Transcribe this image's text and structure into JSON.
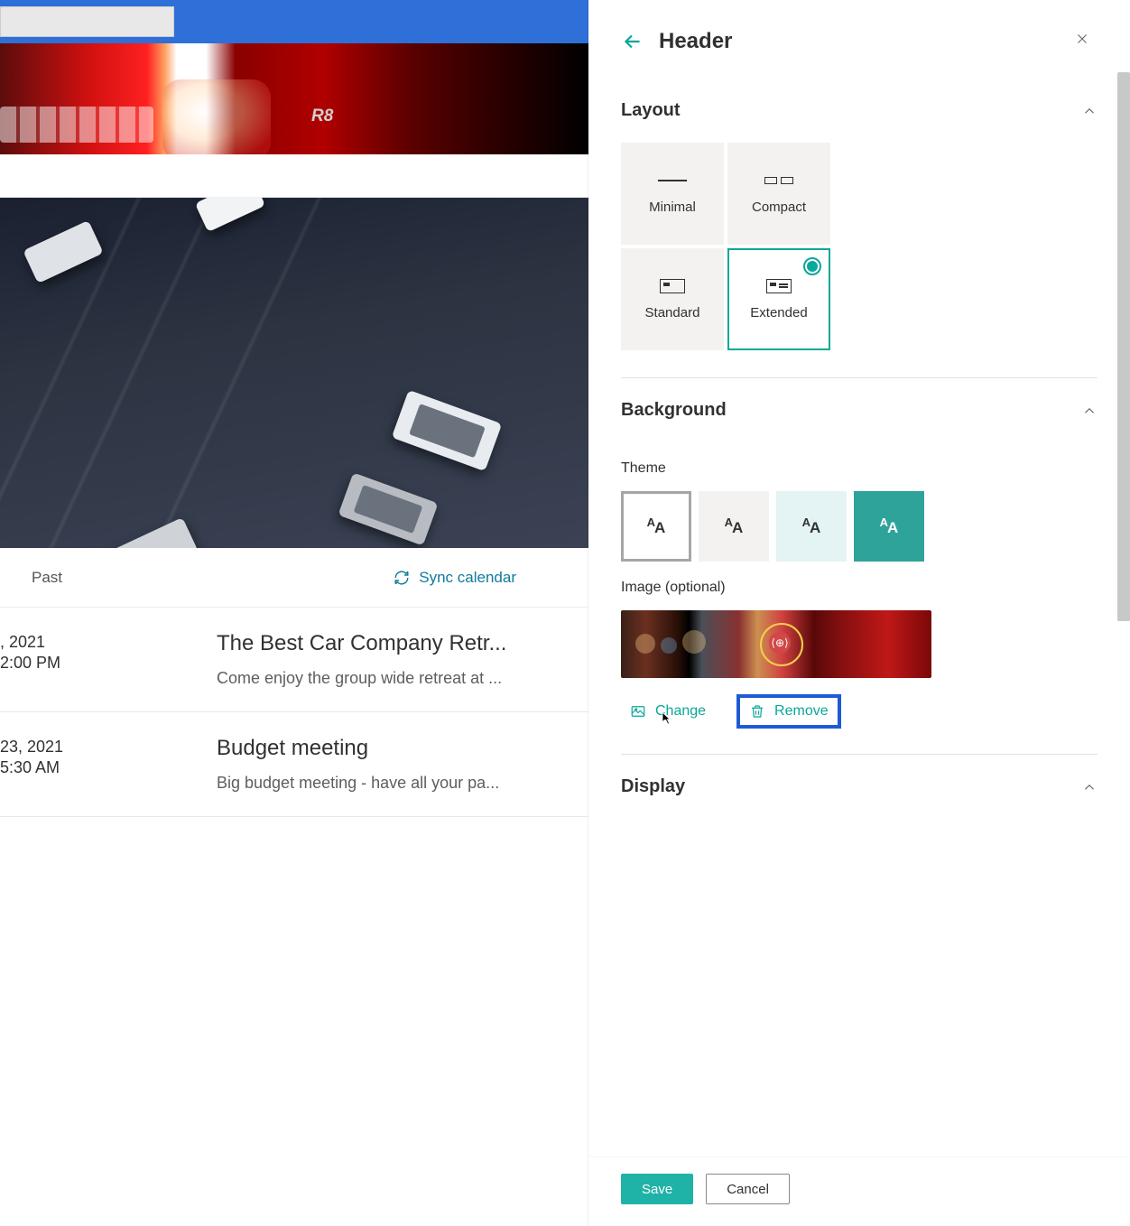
{
  "main": {
    "banner_badge": "R8",
    "tabs": {
      "past": "Past",
      "sync": "Sync calendar"
    },
    "events": [
      {
        "date": ", 2021",
        "time": "2:00 PM",
        "title": "The Best Car Company Retr...",
        "desc": "Come enjoy the group wide retreat at ..."
      },
      {
        "date": "23, 2021",
        "time": "5:30 AM",
        "title": "Budget meeting",
        "desc": "Big budget meeting - have all your pa..."
      }
    ]
  },
  "panel": {
    "title": "Header",
    "sections": {
      "layout": {
        "title": "Layout",
        "options": {
          "minimal": "Minimal",
          "compact": "Compact",
          "standard": "Standard",
          "extended": "Extended"
        },
        "selected": "extended"
      },
      "background": {
        "title": "Background",
        "theme_label": "Theme",
        "image_label": "Image (optional)",
        "change": "Change",
        "remove": "Remove"
      },
      "display": {
        "title": "Display"
      }
    },
    "footer": {
      "save": "Save",
      "cancel": "Cancel"
    }
  },
  "colors": {
    "accent": "#0aa79a",
    "highlight": "#1d5bd6"
  }
}
